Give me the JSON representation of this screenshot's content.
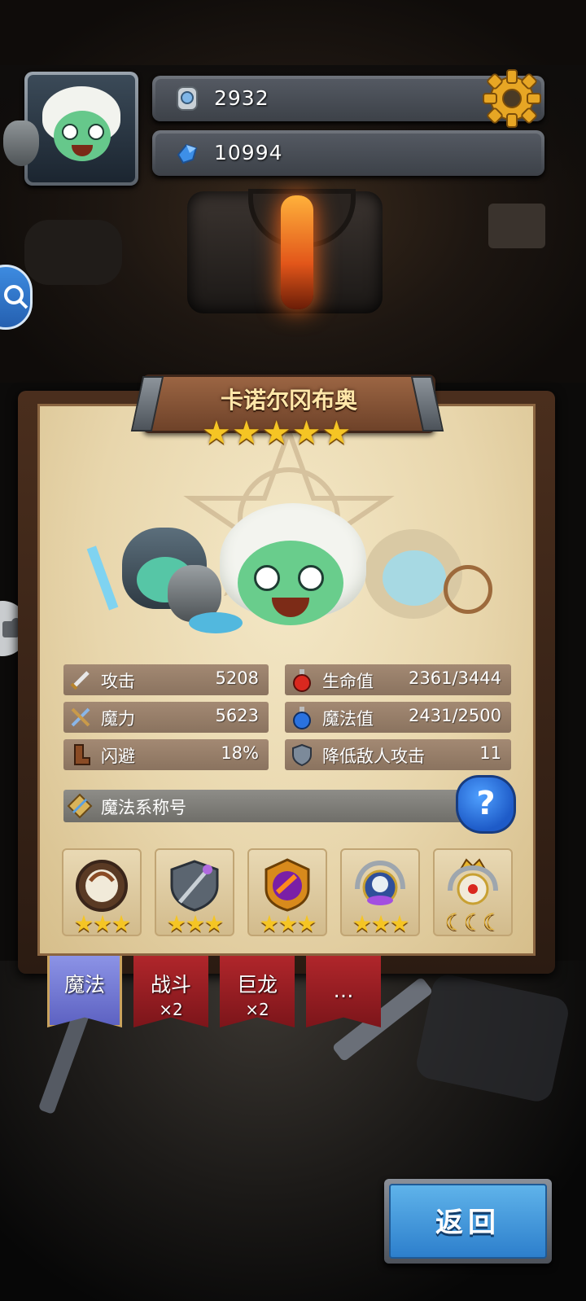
{
  "resources": {
    "gems": "2932",
    "crystals": "10994"
  },
  "hero": {
    "name": "卡诺尔冈布奥",
    "star_count": 5,
    "stars": [
      "★",
      "★",
      "★",
      "★",
      "★"
    ]
  },
  "stats": {
    "attack": {
      "label": "攻击",
      "value": "5208"
    },
    "magic_power": {
      "label": "魔力",
      "value": "5623"
    },
    "dodge": {
      "label": "闪避",
      "value": "18%"
    },
    "hp": {
      "label": "生命值",
      "value": "2361/3444"
    },
    "mp": {
      "label": "魔法值",
      "value": "2431/2500"
    },
    "damage_reduction": {
      "label": "降低敌人攻击",
      "value": "11"
    }
  },
  "title_bar": {
    "label": "魔法系称号",
    "help_glyph": "?"
  },
  "badges": [
    {
      "icon": "horned-beast-medallion-icon",
      "stars": "★★★"
    },
    {
      "icon": "crossed-staff-shield-icon",
      "stars": "★★★"
    },
    {
      "icon": "flame-scroll-emblem-icon",
      "stars": "★★★"
    },
    {
      "icon": "skull-laurel-emblem-icon",
      "stars": "★★★"
    },
    {
      "icon": "crowned-laurel-emblem-icon",
      "stars": "☾☾☾"
    }
  ],
  "tabs": [
    {
      "label": "魔法",
      "sub": "",
      "active": true
    },
    {
      "label": "战斗",
      "sub": "×2",
      "active": false
    },
    {
      "label": "巨龙",
      "sub": "×2",
      "active": false
    },
    {
      "label": "…",
      "sub": "",
      "active": false
    }
  ],
  "back_button": {
    "label": "返回"
  },
  "colors": {
    "star_gold": "#f5c524",
    "tab_active": "#6f75d6",
    "tab_inactive": "#a11f24",
    "button_blue": "#3f94dc",
    "parchment": "#ecdcb4"
  }
}
